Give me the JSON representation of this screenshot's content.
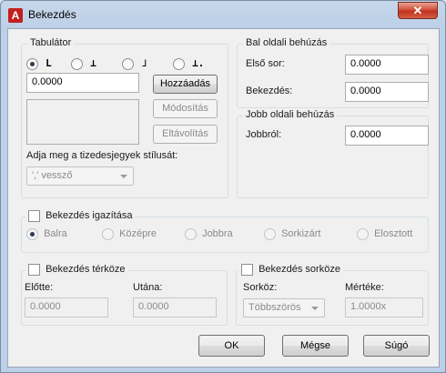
{
  "window": {
    "title": "Bekezdés",
    "close_glyph": "✕",
    "app_icon_letter": "A"
  },
  "tabulator": {
    "legend": "Tabulátor",
    "types": [
      {
        "icon": "left-tab-icon",
        "glyph": "L",
        "checked": true
      },
      {
        "icon": "center-tab-icon",
        "glyph": "⊥",
        "checked": false
      },
      {
        "icon": "right-tab-icon",
        "glyph": "˩",
        "checked": false
      },
      {
        "icon": "decimal-tab-icon",
        "glyph": "⊥.",
        "checked": false
      }
    ],
    "input_value": "0.0000",
    "add_label": "Hozzáadás",
    "modify_label": "Módosítás",
    "remove_label": "Eltávolítás",
    "decimal_style_label": "Adja meg a tizedesjegyek stílusát:",
    "decimal_style_value": "',' vessző"
  },
  "left_indent": {
    "legend": "Bal oldali behúzás",
    "first_line_label": "Első sor:",
    "first_line_value": "0.0000",
    "paragraph_label": "Bekezdés:",
    "paragraph_value": "0.0000"
  },
  "right_indent": {
    "legend": "Jobb oldali behúzás",
    "right_label": "Jobbról:",
    "right_value": "0.0000"
  },
  "alignment": {
    "legend": "Bekezdés igazítása",
    "options": [
      "Balra",
      "Középre",
      "Jobbra",
      "Sorkizárt",
      "Elosztott"
    ]
  },
  "spacing": {
    "legend": "Bekezdés térköze",
    "before_label": "Előtte:",
    "before_value": "0.0000",
    "after_label": "Utána:",
    "after_value": "0.0000"
  },
  "line_spacing": {
    "legend": "Bekezdés sorköze",
    "spacing_label": "Sorköz:",
    "spacing_value": "Többszörös",
    "amount_label": "Mértéke:",
    "amount_value": "1.0000x"
  },
  "buttons": {
    "ok": "OK",
    "cancel": "Mégse",
    "help": "Súgó"
  }
}
